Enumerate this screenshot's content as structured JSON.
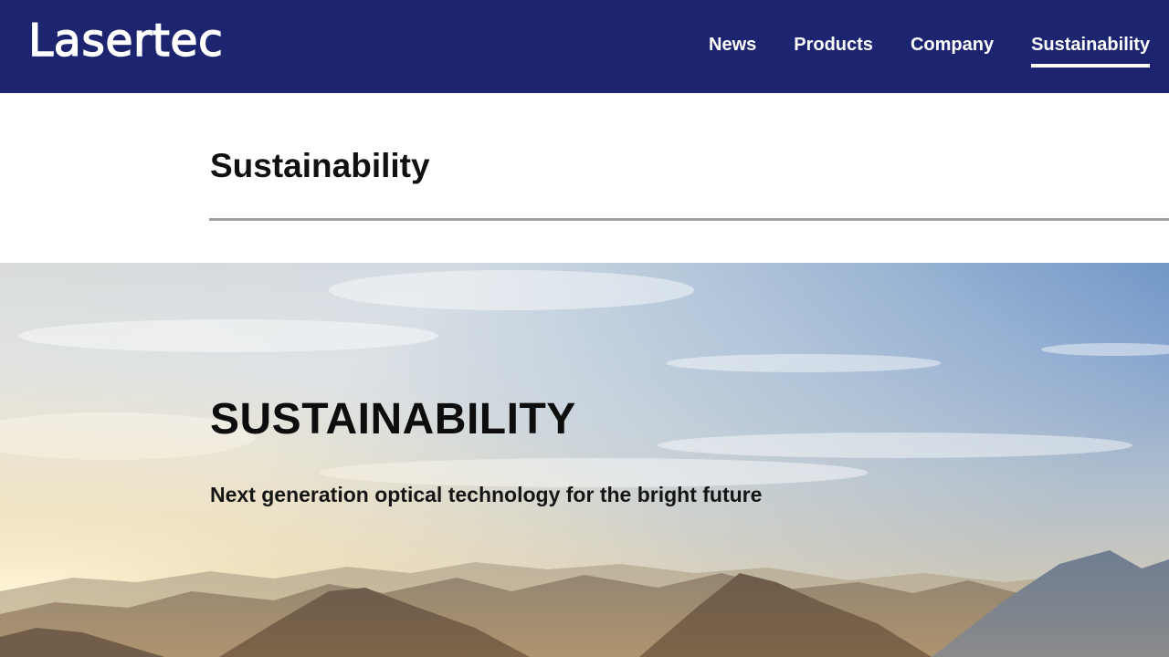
{
  "header": {
    "logo_text": "Lasertec",
    "brand_color": "#1d2570",
    "nav": [
      {
        "label": "News",
        "active": false
      },
      {
        "label": "Products",
        "active": false
      },
      {
        "label": "Company",
        "active": false
      },
      {
        "label": "Sustainability",
        "active": true
      }
    ]
  },
  "page": {
    "title": "Sustainability"
  },
  "hero": {
    "heading": "SUSTAINABILITY",
    "subheading": "Next generation optical technology for the bright future"
  }
}
